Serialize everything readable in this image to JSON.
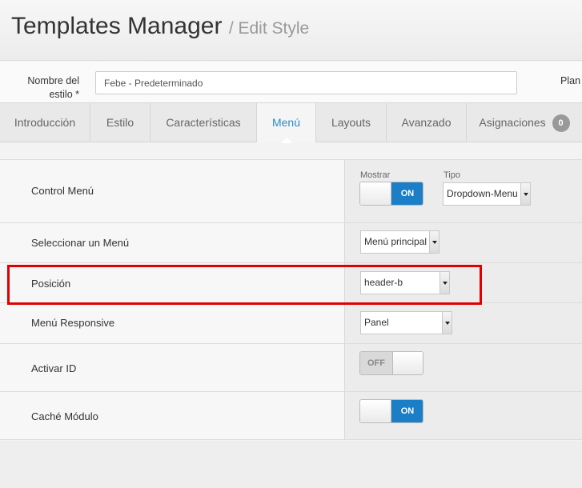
{
  "header": {
    "title": "Templates Manager",
    "subtitle": "/ Edit Style"
  },
  "style_name": {
    "label_line1": "Nombre del",
    "label_line2": "estilo *",
    "value": "Febe - Predeterminado",
    "right_label": "Plan"
  },
  "tabs": [
    {
      "label": "Introducción"
    },
    {
      "label": "Estilo"
    },
    {
      "label": "Características"
    },
    {
      "label": "Menú",
      "active": true
    },
    {
      "label": "Layouts"
    },
    {
      "label": "Avanzado"
    },
    {
      "label": "Asignaciones",
      "badge": "0"
    }
  ],
  "rows": {
    "control_menu": {
      "label": "Control Menú",
      "mostrar_label": "Mostrar",
      "toggle": "ON",
      "tipo_label": "Tipo",
      "tipo_value": "Dropdown-Menu"
    },
    "select_menu": {
      "label": "Seleccionar un Menú",
      "value": "Menú principal"
    },
    "position": {
      "label": "Posición",
      "value": "header-b"
    },
    "responsive": {
      "label": "Menú Responsive",
      "value": "Panel"
    },
    "activar_id": {
      "label": "Activar ID",
      "toggle": "OFF"
    },
    "cache": {
      "label": "Caché Módulo",
      "toggle": "ON"
    }
  },
  "colors": {
    "accent": "#2a8bcc",
    "toggle_on": "#1c7ec7",
    "highlight": "#e10000"
  }
}
